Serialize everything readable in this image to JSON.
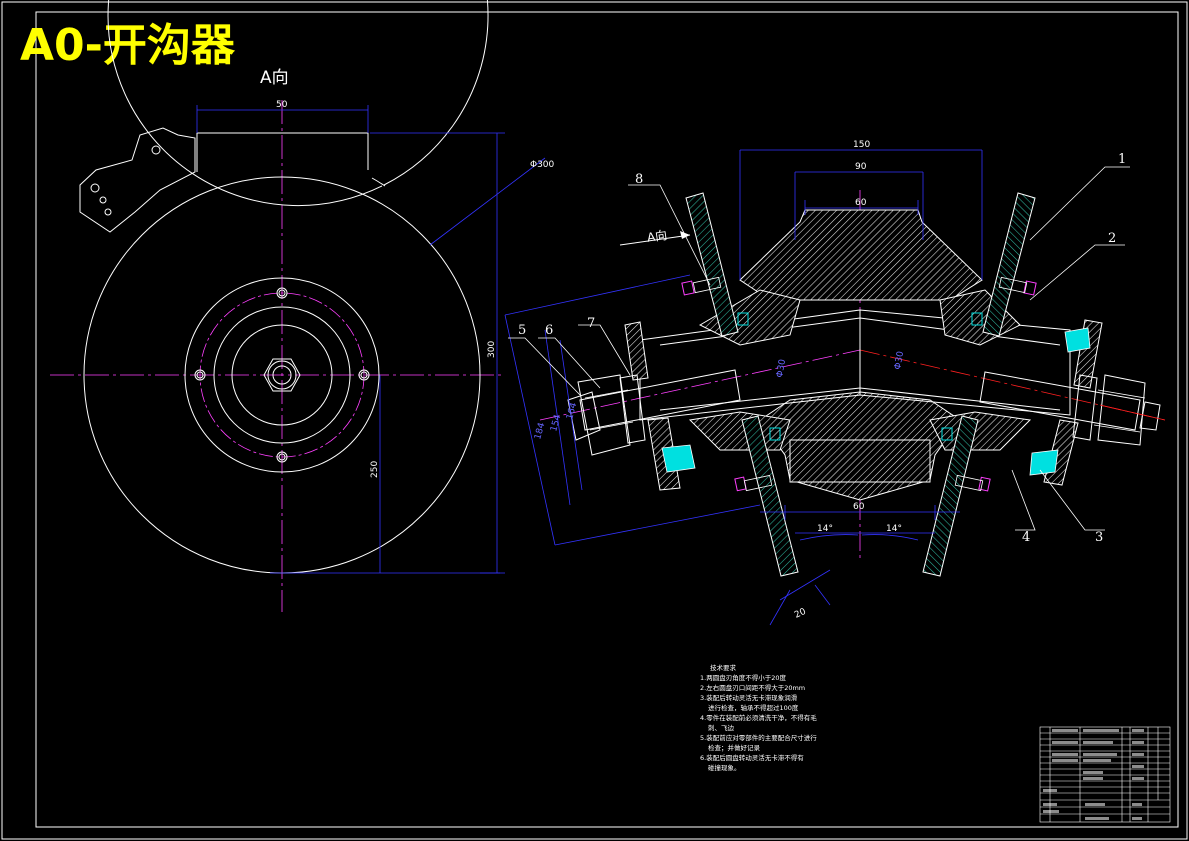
{
  "title": "A0-开沟器",
  "view_label": "A向",
  "arrow_label": "A向",
  "dimensions": {
    "top_width": "50",
    "diameter": "Φ300",
    "height": "300",
    "inner_height": "250",
    "span_150": "150",
    "span_90": "90",
    "span_60": "60",
    "angle_left": "14°",
    "angle_right": "14°",
    "thickness": "20",
    "bottom_60": "60",
    "left_slant_a": "184",
    "left_slant_b": "154",
    "left_slant_c": "164",
    "shaft_left": "Φ30",
    "shaft_right": "Φ30"
  },
  "part_numbers": [
    "1",
    "2",
    "3",
    "4",
    "5",
    "6",
    "7",
    "8"
  ],
  "notes": {
    "heading": "技术要求",
    "lines": [
      "1.两圆盘刃角度不得小于20度",
      "2.左右圆盘刃口间距不得大于20mm",
      "3.装配后转动灵活无卡滞现象润滑",
      "进行检查，轴承不得超过100度",
      "4.零件在装配前必须清洗干净，不得有毛",
      "刺、飞边",
      "5.装配前应对零部件的主要配合尺寸进行",
      "检查；并做好记录",
      "6.装配后圆盘转动灵活无卡滞不得有",
      "碰撞现象。"
    ]
  }
}
